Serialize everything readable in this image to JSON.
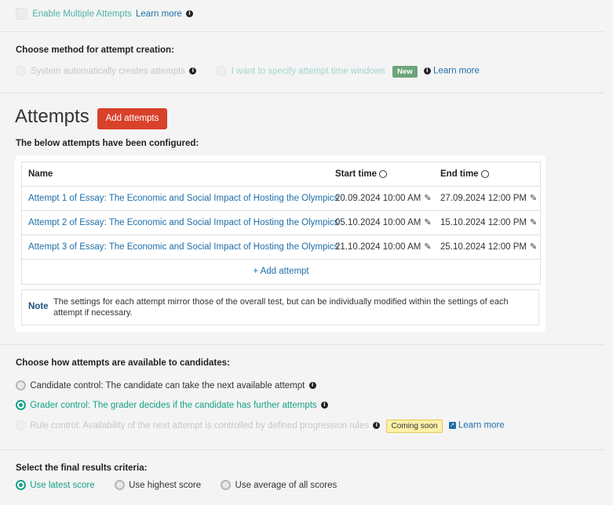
{
  "multiple_attempts": {
    "label": "Enable Multiple Attempts",
    "learn_more": "Learn more"
  },
  "method": {
    "heading": "Choose method for attempt creation:",
    "option_system": "System automatically creates attempts",
    "option_windows": "I want to specify attempt time windows",
    "new_badge": "New",
    "learn_more": "Learn more"
  },
  "attempts": {
    "title": "Attempts",
    "add_button": "Add attempts",
    "configured_label": "The below attempts have been configured:",
    "columns": [
      "Name",
      "Start time",
      "End time"
    ],
    "rows": [
      {
        "name": "Attempt 1 of Essay: The Economic and Social Impact of Hosting the Olympics",
        "start": "20.09.2024 10:00 AM",
        "end": "27.09.2024 12:00 PM"
      },
      {
        "name": "Attempt 2 of Essay: The Economic and Social Impact of Hosting the Olympics",
        "start": "05.10.2024 10:00 AM",
        "end": "15.10.2024 12:00 PM"
      },
      {
        "name": "Attempt 3 of Essay: The Economic and Social Impact of Hosting the Olympics",
        "start": "21.10.2024 10:00 AM",
        "end": "25.10.2024 12:00 PM"
      }
    ],
    "add_attempt_link": "+ Add attempt",
    "note_label": "Note",
    "note_text": "The settings for each attempt mirror those of the overall test, but can be individually modified within the settings of each attempt if necessary."
  },
  "availability": {
    "heading": "Choose how attempts are available to candidates:",
    "candidate_control": "Candidate control: The candidate can take the next available attempt",
    "grader_control": "Grader control: The grader decides if the candidate has further attempts",
    "rule_control": "Rule control: Availability of the next attempt is controlled by defined progression rules",
    "coming_soon": "Coming soon",
    "learn_more": "Learn more"
  },
  "results": {
    "heading": "Select the final results criteria:",
    "latest": "Use latest score",
    "highest": "Use highest score",
    "average": "Use average of all scores"
  },
  "colors": {
    "accent_teal": "#16a085",
    "brand_red": "#d9412b",
    "link_blue": "#1f6ea8",
    "new_green": "#6ea57a",
    "soon_yellow": "#fdf1a8"
  }
}
